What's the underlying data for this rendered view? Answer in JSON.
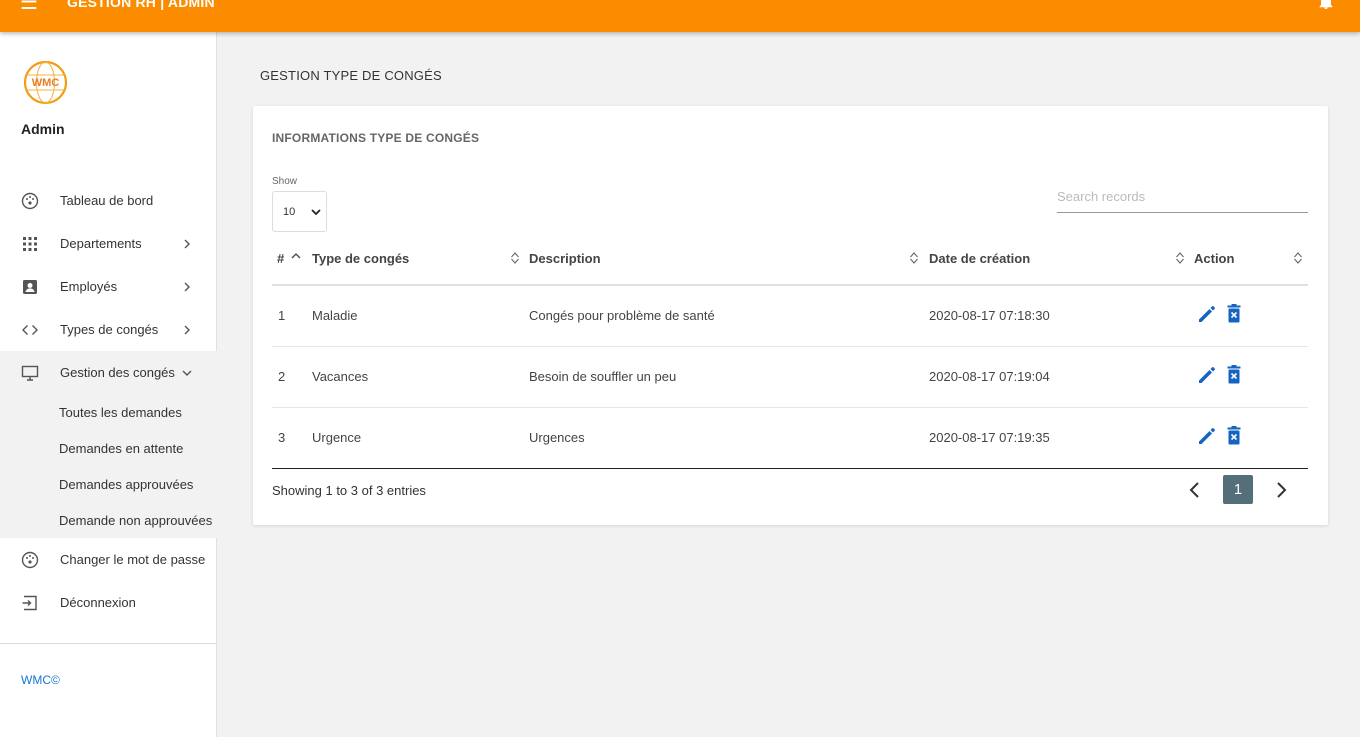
{
  "topbar": {
    "title": "GESTION RH | ADMIN",
    "menu_icon": "menu-icon",
    "bell_icon": "bell-icon",
    "color": "#fb8c00"
  },
  "sidebar": {
    "user_name": "Admin",
    "logo_text": "WMC",
    "items": [
      {
        "label": "Tableau de bord",
        "icon": "dashboard-icon"
      },
      {
        "label": "Departements",
        "icon": "grid-icon"
      },
      {
        "label": "Employés",
        "icon": "contact-icon"
      },
      {
        "label": "Types de congés",
        "icon": "code-icon"
      },
      {
        "label": "Gestion des congés",
        "icon": "monitor-icon"
      },
      {
        "label": "Changer le mot de passe",
        "icon": "dashboard-icon"
      },
      {
        "label": "Déconnexion",
        "icon": "logout-icon"
      }
    ],
    "sub_items": [
      {
        "label": "Toutes les demandes"
      },
      {
        "label": "Demandes en attente"
      },
      {
        "label": "Demandes approuvées"
      },
      {
        "label": "Demande non approuvées"
      }
    ],
    "footer": "WMC©"
  },
  "main": {
    "page_title": "GESTION TYPE DE CONGÉS",
    "card_title": "INFORMATIONS TYPE DE CONGÉS",
    "show_label": "Show",
    "show_value": "10",
    "search_placeholder": "Search records",
    "columns": [
      "#",
      "Type de congés",
      "Description",
      "Date de création",
      "Action"
    ],
    "rows": [
      {
        "id": "1",
        "type": "Maladie",
        "description": "Congés pour problème de santé",
        "date": "2020-08-17 07:18:30"
      },
      {
        "id": "2",
        "type": "Vacances",
        "description": "Besoin de souffler un peu",
        "date": "2020-08-17 07:19:04"
      },
      {
        "id": "3",
        "type": "Urgence",
        "description": "Urgences",
        "date": "2020-08-17 07:19:35"
      }
    ],
    "summary": "Showing 1 to 3 of 3 entries",
    "current_page": "1",
    "action_color": "#1565c0",
    "pager_color": "#546e7a"
  }
}
